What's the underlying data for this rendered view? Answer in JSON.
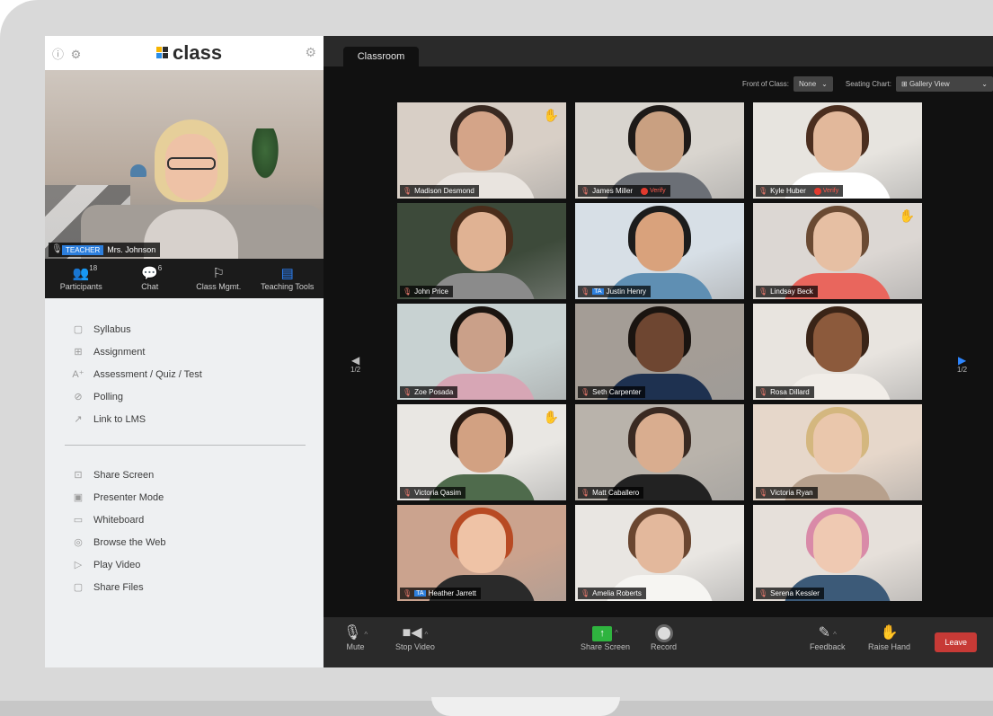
{
  "app": {
    "logo_text": "class",
    "tab": "Classroom"
  },
  "teacher": {
    "role": "TEACHER",
    "name": "Mrs. Johnson"
  },
  "toolbar": [
    {
      "label": "Participants",
      "count": "18"
    },
    {
      "label": "Chat",
      "count": "6"
    },
    {
      "label": "Class Mgmt."
    },
    {
      "label": "Teaching Tools"
    }
  ],
  "menu_group1": [
    "Syllabus",
    "Assignment",
    "Assessment / Quiz / Test",
    "Polling",
    "Link to LMS"
  ],
  "menu_group2": [
    "Share Screen",
    "Presenter Mode",
    "Whiteboard",
    "Browse the Web",
    "Play Video",
    "Share Files"
  ],
  "controls": {
    "front_label": "Front of Class:",
    "front_value": "None",
    "seating_label": "Seating Chart:",
    "seating_value": "Gallery View"
  },
  "students": [
    {
      "name": "Madison Desmond",
      "hand": true
    },
    {
      "name": "James Miller",
      "verify": "Verify"
    },
    {
      "name": "Kyle Huber",
      "verify": "Verify"
    },
    {
      "name": "John Price"
    },
    {
      "name": "Justin Henry",
      "ta": "TA",
      "highlight": true
    },
    {
      "name": "Lindsay Beck",
      "hand": true
    },
    {
      "name": "Zoe Posada"
    },
    {
      "name": "Seth Carpenter"
    },
    {
      "name": "Rosa Dillard"
    },
    {
      "name": "Victoria Qasim",
      "hand": true
    },
    {
      "name": "Matt Caballero"
    },
    {
      "name": "Victoria Ryan"
    },
    {
      "name": "Heather Jarrett",
      "ta": "TA",
      "highlight": true
    },
    {
      "name": "Amelia Roberts"
    },
    {
      "name": "Serena Kessler"
    }
  ],
  "pager": {
    "left": "1/2",
    "right": "1/2"
  },
  "bottom": {
    "mute": "Mute",
    "stop_video": "Stop Video",
    "share_screen": "Share Screen",
    "record": "Record",
    "feedback": "Feedback",
    "raise_hand": "Raise Hand",
    "leave": "Leave"
  }
}
